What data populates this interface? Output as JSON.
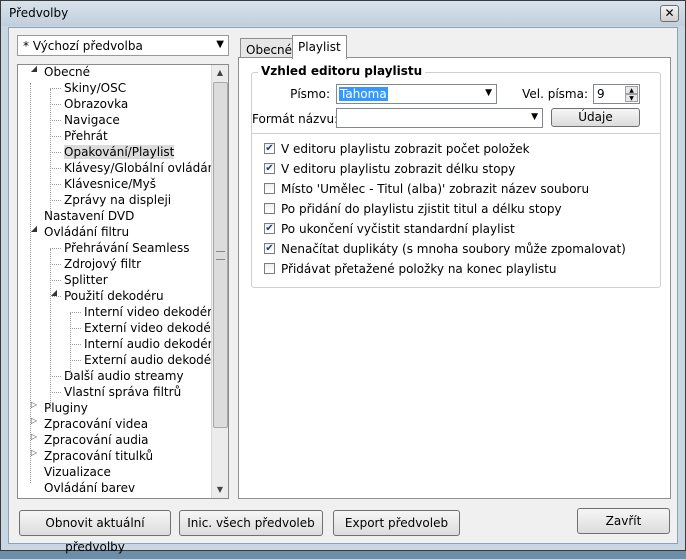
{
  "window": {
    "title": "Předvolby",
    "close_glyph": "✕"
  },
  "preset_select": {
    "value": "* Výchozí předvolba"
  },
  "tree": [
    {
      "label": "Obecné",
      "level": 0,
      "toggle": "expanded"
    },
    {
      "label": "Skiny/OSC",
      "level": 1
    },
    {
      "label": "Obrazovka",
      "level": 1
    },
    {
      "label": "Navigace",
      "level": 1
    },
    {
      "label": "Přehrát",
      "level": 1
    },
    {
      "label": "Opakování/Playlist",
      "level": 1,
      "selected": true
    },
    {
      "label": "Klávesy/Globální ovládání",
      "level": 1
    },
    {
      "label": "Klávesnice/Myš",
      "level": 1
    },
    {
      "label": "Zprávy na displeji",
      "level": 1
    },
    {
      "label": "Nastavení DVD",
      "level": 0
    },
    {
      "label": "Ovládání filtru",
      "level": 0,
      "toggle": "expanded"
    },
    {
      "label": "Přehrávání Seamless",
      "level": 1
    },
    {
      "label": "Zdrojový filtr",
      "level": 1
    },
    {
      "label": "Splitter",
      "level": 1
    },
    {
      "label": "Použití dekodéru",
      "level": 1,
      "toggle": "expanded"
    },
    {
      "label": "Interní video dekodér",
      "level": 2
    },
    {
      "label": "Externí video dekodér",
      "level": 2
    },
    {
      "label": "Interní audio dekodér",
      "level": 2
    },
    {
      "label": "Externí audio dekodér",
      "level": 2
    },
    {
      "label": "Další audio streamy",
      "level": 1
    },
    {
      "label": "Vlastní správa filtrů",
      "level": 1
    },
    {
      "label": "Pluginy",
      "level": 0,
      "toggle": "collapsed"
    },
    {
      "label": "Zpracování videa",
      "level": 0,
      "toggle": "collapsed"
    },
    {
      "label": "Zpracování audia",
      "level": 0,
      "toggle": "collapsed"
    },
    {
      "label": "Zpracování titulků",
      "level": 0,
      "toggle": "collapsed"
    },
    {
      "label": "Vizualizace",
      "level": 0
    },
    {
      "label": "Ovládání barev",
      "level": 0
    }
  ],
  "tabs": {
    "general": "Obecné",
    "playlist": "Playlist"
  },
  "group": {
    "title": "Vzhled editoru playlistu",
    "font_label": "Písmo:",
    "font_value": "Tahoma",
    "font_size_label": "Vel. písma:",
    "font_size_value": "9",
    "name_format_label": "Formát názvu:",
    "name_format_value": "",
    "details_button": "Údaje",
    "checkboxes": [
      {
        "label": "V editoru playlistu zobrazit počet položek",
        "checked": true
      },
      {
        "label": "V editoru playlistu zobrazit délku stopy",
        "checked": true
      },
      {
        "label": "Místo 'Umělec - Titul (alba)' zobrazit název souboru",
        "checked": false
      },
      {
        "label": "Po přidání do playlistu zjistit titul a délku stopy",
        "checked": false
      },
      {
        "label": "Po ukončení vyčistit standardní playlist",
        "checked": true
      },
      {
        "label": "Nenačítat duplikáty (s mnoha soubory může zpomalovat)",
        "checked": true
      },
      {
        "label": "Přidávat přetažené položky na konec playlistu",
        "checked": false
      }
    ]
  },
  "buttons": {
    "reset_current": "Obnovit aktuální předvolby",
    "init_all": "Inic. všech předvoleb",
    "export": "Export předvoleb",
    "close": "Zavřít"
  }
}
